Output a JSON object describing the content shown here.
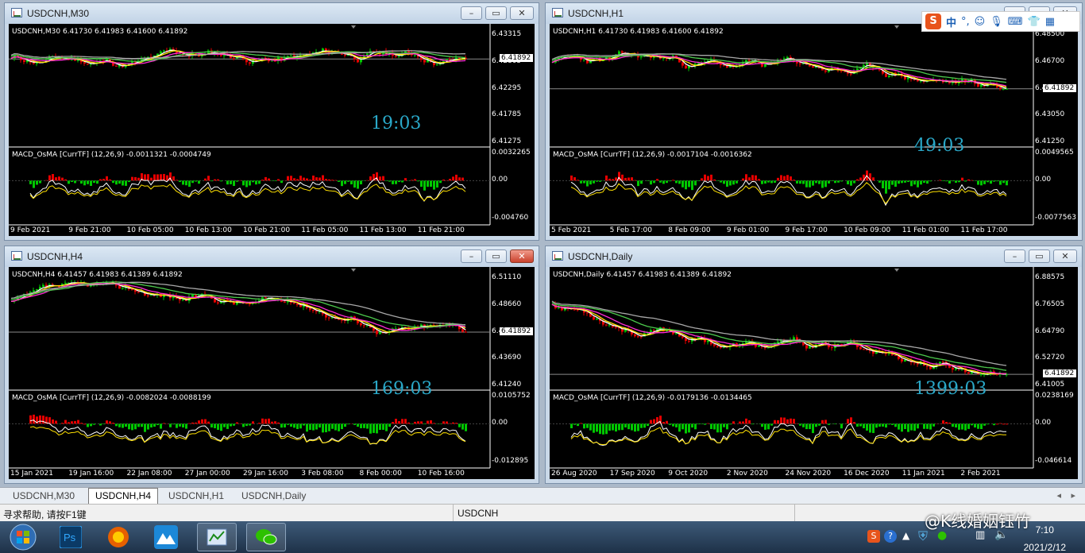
{
  "windows": [
    {
      "title": "USDCNH,M30",
      "ohlc": "USDCNH,M30  6.41730 6.41983 6.41600 6.41892",
      "macd": "MACD_OsMA [CurrTF] (12,26,9) -0.0011321 -0.0004749",
      "price_ticks": [
        "6.43315",
        "6.42805",
        "6.42295",
        "6.41785",
        "6.41275"
      ],
      "current_price": "6.41892",
      "macd_ticks": [
        "0.0032265",
        "0.00",
        "-0.004760"
      ],
      "time_ticks": [
        "9 Feb 2021",
        "9 Feb 21:00",
        "10 Feb 05:00",
        "10 Feb 13:00",
        "10 Feb 21:00",
        "11 Feb 05:00",
        "11 Feb 13:00",
        "11 Feb 21:00"
      ],
      "timer": "19:03",
      "close_red": false
    },
    {
      "title": "USDCNH,H1",
      "ohlc": "USDCNH,H1  6.41730 6.41983 6.41600 6.41892",
      "macd": "MACD_OsMA [CurrTF] (12,26,9) -0.0017104 -0.0016362",
      "price_ticks": [
        "6.48500",
        "6.46700",
        "6.44900",
        "6.43050",
        "6.41250"
      ],
      "current_price": "6.41892",
      "macd_ticks": [
        "0.0049565",
        "0.00",
        "-0.0077563"
      ],
      "time_ticks": [
        "5 Feb 2021",
        "5 Feb 17:00",
        "8 Feb 09:00",
        "9 Feb 01:00",
        "9 Feb 17:00",
        "10 Feb 09:00",
        "11 Feb 01:00",
        "11 Feb 17:00"
      ],
      "timer": "49:03",
      "close_red": false
    },
    {
      "title": "USDCNH,H4",
      "ohlc": "USDCNH,H4  6.41457 6.41983 6.41389 6.41892",
      "macd": "MACD_OsMA [CurrTF] (12,26,9) -0.0082024 -0.0088199",
      "price_ticks": [
        "6.51110",
        "6.48660",
        "6.46140",
        "6.43690",
        "6.41240"
      ],
      "current_price": "6.41892",
      "macd_ticks": [
        "0.0105752",
        "0.00",
        "-0.012895"
      ],
      "time_ticks": [
        "15 Jan 2021",
        "19 Jan 16:00",
        "22 Jan 08:00",
        "27 Jan 00:00",
        "29 Jan 16:00",
        "3 Feb 08:00",
        "8 Feb 00:00",
        "10 Feb 16:00"
      ],
      "timer": "169:03",
      "close_red": true
    },
    {
      "title": "USDCNH,Daily",
      "ohlc": "USDCNH,Daily  6.41457 6.41983 6.41389 6.41892",
      "macd": "MACD_OsMA [CurrTF] (12,26,9) -0.0179136 -0.0134465",
      "price_ticks": [
        "6.88575",
        "6.76505",
        "6.64790",
        "6.52720",
        "6.41005"
      ],
      "current_price": "6.41892",
      "macd_ticks": [
        "0.0238169",
        "0.00",
        "-0.046614"
      ],
      "time_ticks": [
        "26 Aug 2020",
        "17 Sep 2020",
        "9 Oct 2020",
        "2 Nov 2020",
        "24 Nov 2020",
        "16 Dec 2020",
        "11 Jan 2021",
        "2 Feb 2021"
      ],
      "timer": "1399:03",
      "close_red": false
    }
  ],
  "tabs": [
    "USDCNH,M30",
    "USDCNH,H4",
    "USDCNH,H1",
    "USDCNH,Daily"
  ],
  "active_tab": 1,
  "status": {
    "help": "寻求帮助, 请按F1键",
    "symbol": "USDCNH"
  },
  "ime": {
    "lang": "中",
    "punct": "°,"
  },
  "clock": {
    "time": "7:10",
    "date": "2021/2/12"
  },
  "watermark": "@K线婚姻钰竹",
  "colors": {
    "bull": "#00c800",
    "bear": "#e60000",
    "ma_white": "#ffffff",
    "ma_yellow": "#ffe100",
    "ma_magenta": "#ff2bd6",
    "ma_green": "#4cc94c",
    "ma_gray": "#a8a8a8",
    "timer": "#2aa8c8"
  }
}
